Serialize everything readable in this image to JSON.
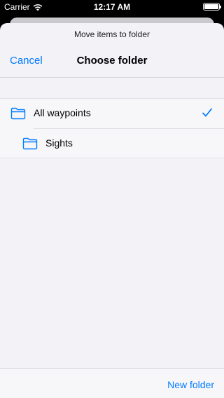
{
  "status_bar": {
    "carrier": "Carrier",
    "time": "12:17 AM"
  },
  "sheet": {
    "prompt": "Move items to folder",
    "cancel_label": "Cancel",
    "title": "Choose folder"
  },
  "folders": [
    {
      "label": "All waypoints",
      "selected": true,
      "icon": "folder-icon"
    },
    {
      "label": "Sights",
      "selected": false,
      "icon": "folder-icon"
    }
  ],
  "toolbar": {
    "new_folder_label": "New folder"
  },
  "colors": {
    "accent": "#007aff",
    "background": "#f2f2f7"
  }
}
